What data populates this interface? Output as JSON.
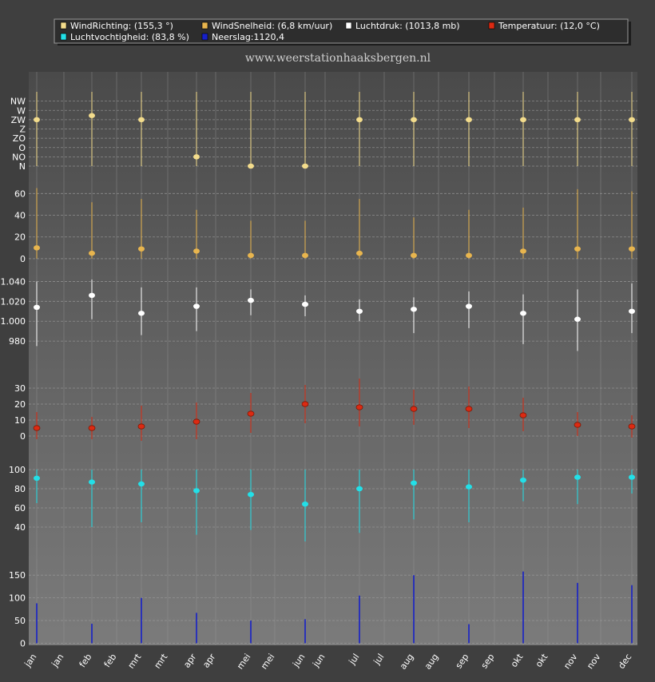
{
  "legend": {
    "items": [
      {
        "label": "WindRichting: (155,3 °)",
        "color": "#f3dc8c"
      },
      {
        "label": "WindSnelheid: (6,8 km/uur)",
        "color": "#e8b54e"
      },
      {
        "label": "Luchtdruk: (1013,8 mb)",
        "color": "#ffffff"
      },
      {
        "label": "Temperatuur: (12,0 °C)",
        "color": "#dc2a12"
      },
      {
        "label": "Luchtvochtigheid: (83,8 %)",
        "color": "#22e0e8"
      },
      {
        "label": "Neerslag:1120,4",
        "color": "#1620c8"
      }
    ]
  },
  "watermark": "www.weerstationhaaksbergen.nl",
  "x_tick_labels": [
    "jan",
    "jan",
    "feb",
    "feb",
    "mrt",
    "mrt",
    "apr",
    "apr",
    "mei",
    "mei",
    "jun",
    "jun",
    "jul",
    "jul",
    "aug",
    "aug",
    "sep",
    "sep",
    "okt",
    "okt",
    "nov",
    "nov",
    "dec"
  ],
  "colors": {
    "background": "#3f3f3f",
    "plot_top": "#4a4a4a",
    "plot_bottom": "#7b7b7b",
    "grid": "#9a9a9a",
    "tick_text": "#ffffff"
  },
  "chart_data": [
    {
      "type": "scatter",
      "name": "WindRichting",
      "color": "#f3dc8c",
      "x": [
        "jan",
        "feb",
        "mrt",
        "apr",
        "mei",
        "jun",
        "jul",
        "aug",
        "sep",
        "okt",
        "nov",
        "dec"
      ],
      "values": [
        225,
        245,
        225,
        45,
        0,
        0,
        225,
        225,
        225,
        225,
        225,
        225
      ],
      "ranges": [
        [
          0,
          360
        ],
        [
          0,
          360
        ],
        [
          0,
          360
        ],
        [
          0,
          360
        ],
        [
          0,
          360
        ],
        [
          0,
          360
        ],
        [
          0,
          360
        ],
        [
          0,
          360
        ],
        [
          0,
          360
        ],
        [
          0,
          360
        ],
        [
          0,
          360
        ],
        [
          0,
          360
        ]
      ],
      "ylim": [
        0,
        360
      ],
      "y_ticks": [
        {
          "value": 0,
          "label": "N"
        },
        {
          "value": 45,
          "label": "NO"
        },
        {
          "value": 90,
          "label": "O"
        },
        {
          "value": 135,
          "label": "ZO"
        },
        {
          "value": 180,
          "label": "Z"
        },
        {
          "value": 225,
          "label": "ZW"
        },
        {
          "value": 270,
          "label": "W"
        },
        {
          "value": 315,
          "label": "NW"
        }
      ]
    },
    {
      "type": "scatter",
      "name": "WindSnelheid",
      "color": "#e8b54e",
      "x": [
        "jan",
        "feb",
        "mrt",
        "apr",
        "mei",
        "jun",
        "jul",
        "aug",
        "sep",
        "okt",
        "nov",
        "dec"
      ],
      "values": [
        10,
        5,
        9,
        7,
        3,
        3,
        5,
        3,
        3,
        7,
        9,
        9
      ],
      "ranges": [
        [
          0,
          65
        ],
        [
          0,
          52
        ],
        [
          0,
          55
        ],
        [
          0,
          45
        ],
        [
          0,
          35
        ],
        [
          0,
          35
        ],
        [
          0,
          55
        ],
        [
          0,
          38
        ],
        [
          0,
          45
        ],
        [
          0,
          47
        ],
        [
          0,
          64
        ],
        [
          0,
          62
        ]
      ],
      "ylim": [
        -3,
        72
      ],
      "y_ticks": [
        {
          "value": 0,
          "label": "0"
        },
        {
          "value": 20,
          "label": "20"
        },
        {
          "value": 40,
          "label": "40"
        },
        {
          "value": 60,
          "label": "60"
        }
      ]
    },
    {
      "type": "scatter",
      "name": "Luchtdruk",
      "color": "#ffffff",
      "x": [
        "jan",
        "feb",
        "mrt",
        "apr",
        "mei",
        "jun",
        "jul",
        "aug",
        "sep",
        "okt",
        "nov",
        "dec"
      ],
      "values": [
        1014,
        1026,
        1008,
        1015,
        1021,
        1017,
        1010,
        1012,
        1015,
        1008,
        1002,
        1010
      ],
      "ranges": [
        [
          975,
          1040
        ],
        [
          1002,
          1042
        ],
        [
          986,
          1034
        ],
        [
          990,
          1034
        ],
        [
          1006,
          1032
        ],
        [
          1005,
          1026
        ],
        [
          1000,
          1022
        ],
        [
          988,
          1024
        ],
        [
          993,
          1030
        ],
        [
          977,
          1027
        ],
        [
          970,
          1032
        ],
        [
          988,
          1038
        ]
      ],
      "ylim": [
        960,
        1050
      ],
      "y_ticks": [
        {
          "value": 980,
          "label": "980"
        },
        {
          "value": 1000,
          "label": "1.000"
        },
        {
          "value": 1020,
          "label": "1.020"
        },
        {
          "value": 1040,
          "label": "1.040"
        }
      ]
    },
    {
      "type": "scatter",
      "name": "Temperatuur",
      "color": "#dc2a12",
      "x": [
        "jan",
        "feb",
        "mrt",
        "apr",
        "mei",
        "jun",
        "jul",
        "aug",
        "sep",
        "okt",
        "nov",
        "dec"
      ],
      "values": [
        5,
        5,
        6,
        9,
        14,
        20,
        18,
        17,
        17,
        13,
        7,
        6
      ],
      "ranges": [
        [
          -2,
          15
        ],
        [
          -2,
          12
        ],
        [
          -3,
          19
        ],
        [
          -2,
          21
        ],
        [
          2,
          27
        ],
        [
          8,
          32
        ],
        [
          6,
          36
        ],
        [
          7,
          29
        ],
        [
          5,
          31
        ],
        [
          3,
          24
        ],
        [
          0,
          15
        ],
        [
          -1,
          13
        ]
      ],
      "ylim": [
        -6,
        40
      ],
      "y_ticks": [
        {
          "value": 0,
          "label": "0"
        },
        {
          "value": 10,
          "label": "10"
        },
        {
          "value": 20,
          "label": "20"
        },
        {
          "value": 30,
          "label": "30"
        }
      ]
    },
    {
      "type": "scatter",
      "name": "Luchtvochtigheid",
      "color": "#22e0e8",
      "x": [
        "jan",
        "feb",
        "mrt",
        "apr",
        "mei",
        "jun",
        "jul",
        "aug",
        "sep",
        "okt",
        "nov",
        "dec"
      ],
      "values": [
        91,
        87,
        85,
        78,
        74,
        64,
        80,
        86,
        82,
        89,
        92,
        92
      ],
      "ranges": [
        [
          65,
          100
        ],
        [
          40,
          100
        ],
        [
          45,
          100
        ],
        [
          32,
          100
        ],
        [
          37,
          100
        ],
        [
          25,
          100
        ],
        [
          34,
          100
        ],
        [
          48,
          100
        ],
        [
          45,
          100
        ],
        [
          67,
          100
        ],
        [
          64,
          100
        ],
        [
          75,
          100
        ]
      ],
      "ylim": [
        20,
        105
      ],
      "y_ticks": [
        {
          "value": 40,
          "label": "40"
        },
        {
          "value": 60,
          "label": "60"
        },
        {
          "value": 80,
          "label": "80"
        },
        {
          "value": 100,
          "label": "100"
        }
      ]
    },
    {
      "type": "bar",
      "name": "Neerslag",
      "color": "#1620c8",
      "x": [
        "jan",
        "feb",
        "mrt",
        "apr",
        "mei",
        "jun",
        "jul",
        "aug",
        "sep",
        "okt",
        "nov",
        "dec"
      ],
      "values": [
        88,
        43,
        100,
        67,
        50,
        53,
        105,
        150,
        42,
        158,
        133,
        128
      ],
      "ylim": [
        -8,
        175
      ],
      "y_ticks": [
        {
          "value": 0,
          "label": "0"
        },
        {
          "value": 50,
          "label": "50"
        },
        {
          "value": 100,
          "label": "100"
        },
        {
          "value": 150,
          "label": "150"
        }
      ]
    }
  ]
}
